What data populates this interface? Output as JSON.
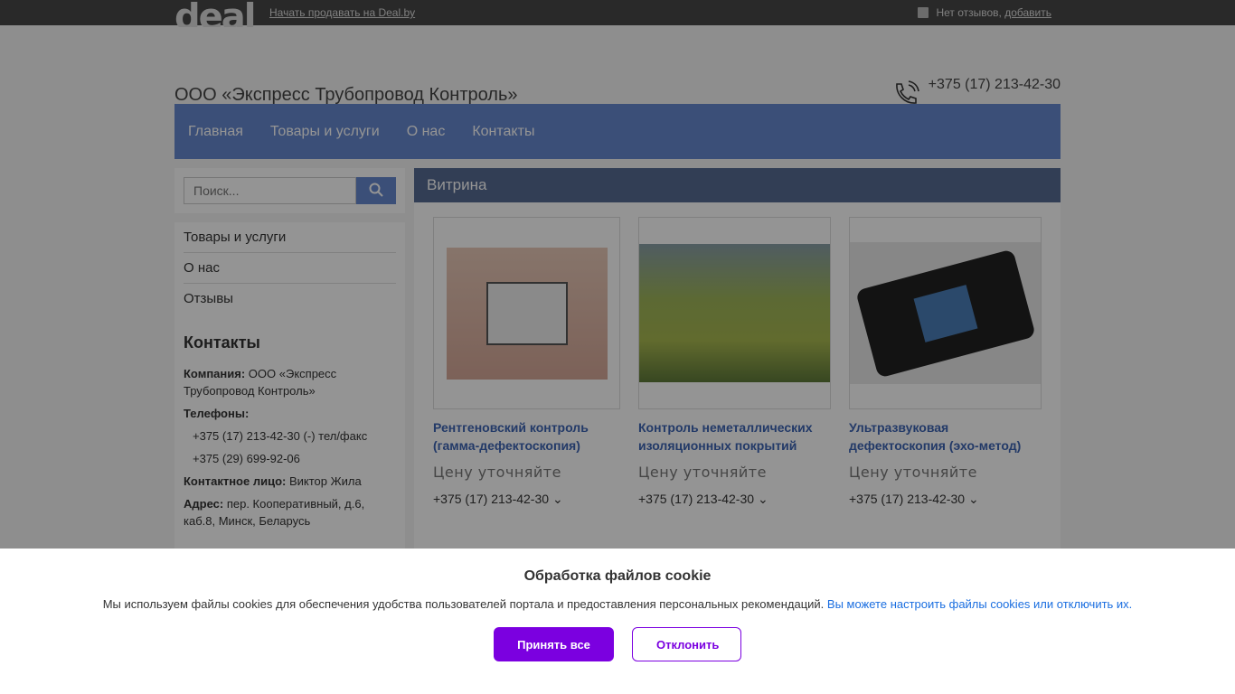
{
  "topbar": {
    "logo": "deal",
    "sell_link": "Начать продавать на Deal.by",
    "reviews_text": "Нет отзывов, ",
    "reviews_link": "добавить"
  },
  "header": {
    "company": "ООО «Экспресс Трубопровод Контроль»",
    "phones": [
      "+375 (17) 213-42-30",
      "+375 (29) 699-92-06"
    ]
  },
  "nav": [
    "Главная",
    "Товары и услуги",
    "О нас",
    "Контакты"
  ],
  "search": {
    "placeholder": "Поиск..."
  },
  "sidebar": {
    "menu": [
      "Товары и услуги",
      "О нас",
      "Отзывы"
    ],
    "contacts_title": "Контакты",
    "company_label": "Компания:",
    "company": "ООО «Экспресс Трубопровод Контроль»",
    "phones_label": "Телефоны:",
    "phone1": "+375 (17) 213-42-30",
    "phone1_note": "(-) тел/факс",
    "phone2": "+375 (29) 699-92-06",
    "person_label": "Контактное лицо:",
    "person": "Виктор Жила",
    "address_label": "Адрес:",
    "address": "пер. Кооперативный, д.6, каб.8, Минск, Беларусь"
  },
  "main": {
    "title": "Витрина",
    "products": [
      {
        "title": "Рентгеновский контроль (гамма-дефектоскопия)",
        "price": "Цену уточняйте",
        "phone": "+375 (17) 213-42-30"
      },
      {
        "title": "Контроль неметаллических изоляционных покрытий",
        "price": "Цену уточняйте",
        "phone": "+375 (17) 213-42-30"
      },
      {
        "title": "Ультразвуковая дефектоскопия (эхо-метод)",
        "price": "Цену уточняйте",
        "phone": "+375 (17) 213-42-30"
      }
    ]
  },
  "cookie": {
    "title": "Обработка файлов cookie",
    "text": "Мы используем файлы cookies для обеспечения удобства пользователей портала и предоставления персональных рекомендаций. ",
    "link": "Вы можете настроить файлы cookies или отключить их.",
    "accept": "Принять все",
    "decline": "Отклонить"
  }
}
